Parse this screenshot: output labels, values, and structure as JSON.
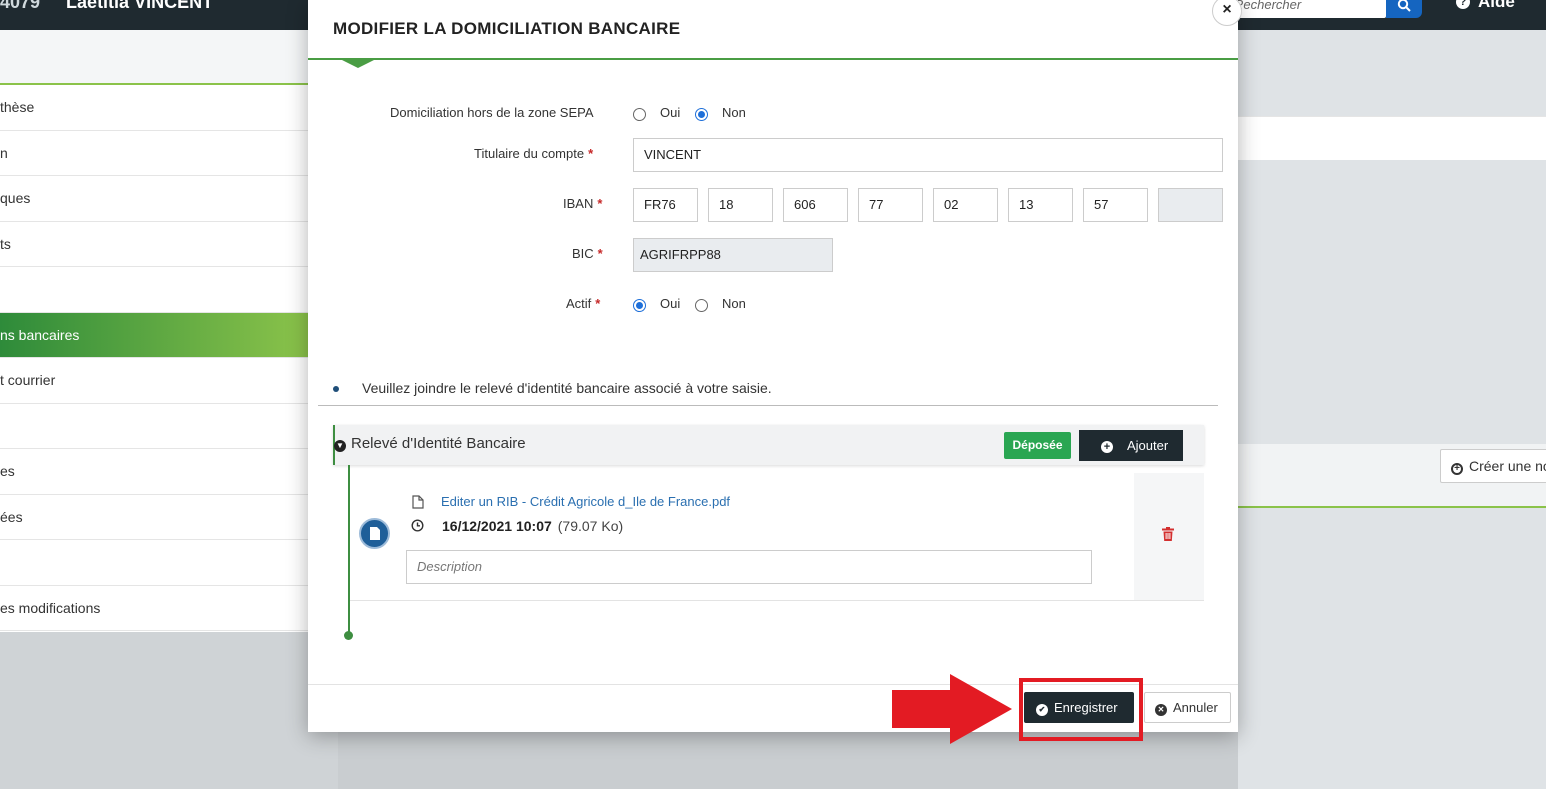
{
  "app": {
    "user_code": "4079",
    "user_name": "Laetitia VINCENT",
    "search_placeholder": "Rechercher",
    "help_label": "Aide",
    "create_button": "Créer une no"
  },
  "sidebar": {
    "items": [
      {
        "label": "thèse"
      },
      {
        "label": "n"
      },
      {
        "label": "ques"
      },
      {
        "label": "ts"
      },
      {
        "label": ""
      },
      {
        "label": "ns bancaires",
        "active": true
      },
      {
        "label": "t courrier"
      },
      {
        "label": ""
      },
      {
        "label": "es"
      },
      {
        "label": "ées"
      },
      {
        "label": ""
      },
      {
        "label": "es modifications"
      }
    ]
  },
  "modal": {
    "title": "MODIFIER LA DOMICILIATION BANCAIRE",
    "close_glyph": "×",
    "fields": {
      "sepa_label": "Domiciliation hors de la zone SEPA",
      "sepa_options": [
        "Oui",
        "Non"
      ],
      "sepa_selected": "Non",
      "holder_label": "Titulaire du compte",
      "holder_value": "VINCENT",
      "iban_label": "IBAN",
      "iban_parts": [
        "FR76",
        "18",
        "606",
        "77",
        "02",
        "13",
        "57",
        ""
      ],
      "bic_label": "BIC",
      "bic_value": "AGRIFRPP88",
      "active_label": "Actif",
      "active_options": [
        "Oui",
        "Non"
      ],
      "active_selected": "Oui",
      "required_mark": "*"
    },
    "info_text": "Veuillez joindre le relevé d'identité bancaire associé à votre saisie.",
    "attachment": {
      "section_title": "Relevé d'Identité Bancaire",
      "status_badge": "Déposée",
      "add_label": "Ajouter",
      "file_name": "Editer un RIB - Crédit Agricole d_Ile de France.pdf",
      "date": "16/12/2021 10:07",
      "size": "(79.07 Ko)",
      "description_placeholder": "Description"
    },
    "footer": {
      "save_label": "Enregistrer",
      "cancel_label": "Annuler"
    }
  },
  "colors": {
    "accent_green": "#4a9d44",
    "dark_button": "#1f2a30",
    "badge_green": "#2aa652",
    "annotation_red": "#e31b23",
    "link_blue": "#2a6fb0"
  }
}
